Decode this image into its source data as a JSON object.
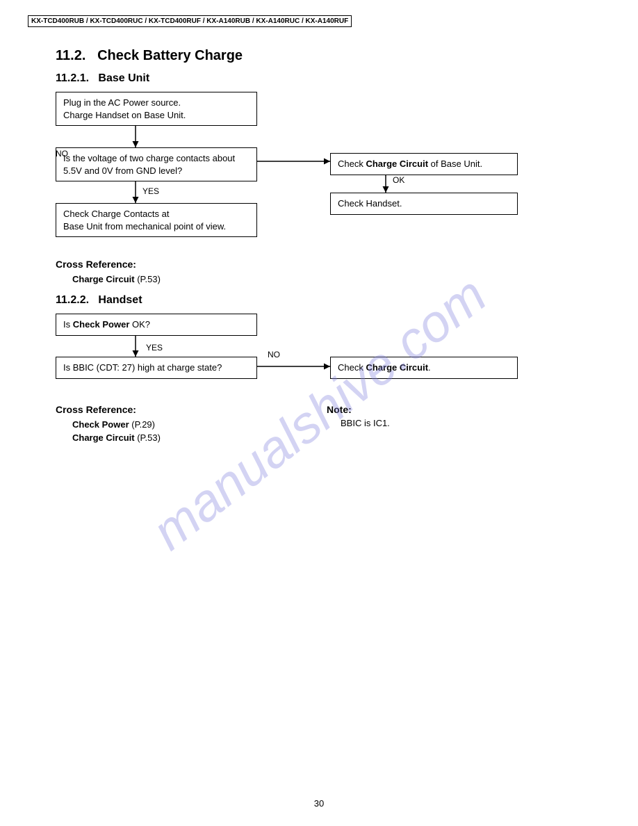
{
  "header": {
    "models": "KX-TCD400RUB / KX-TCD400RUC / KX-TCD400RUF / KX-A140RUB / KX-A140RUC / KX-A140RUF"
  },
  "section": {
    "number": "11.2.",
    "title": "Check Battery Charge"
  },
  "subsection1": {
    "number": "11.2.1.",
    "title": "Base Unit",
    "box1_line1": "Plug in the AC Power source.",
    "box1_line2": "Charge Handset on Base Unit.",
    "box2_line1": "Is the voltage of two charge contacts about",
    "box2_line2": "5.5V and 0V from GND level?",
    "box3_pre": "Check ",
    "box3_bold": "Charge Circuit",
    "box3_post": " of Base Unit.",
    "box4": "Check Handset.",
    "box5_line1": "Check Charge Contacts at",
    "box5_line2": "Base Unit from mechanical point of view.",
    "label_no": "NO",
    "label_ok": "OK",
    "label_yes": "YES",
    "cross_ref_title": "Cross Reference:",
    "cross_ref_item_bold": "Charge Circuit",
    "cross_ref_item_page": " (P.53)"
  },
  "subsection2": {
    "number": "11.2.2.",
    "title": "Handset",
    "box1_pre": "Is ",
    "box1_bold": "Check Power",
    "box1_post": " OK?",
    "box2": "Is BBIC (CDT: 27) high at charge state?",
    "box3_pre": "Check ",
    "box3_bold": "Charge Circuit",
    "box3_post": ".",
    "label_yes": "YES",
    "label_no": "NO",
    "cross_ref_title": "Cross Reference:",
    "cross_ref_item1_bold": "Check Power",
    "cross_ref_item1_page": " (P.29)",
    "cross_ref_item2_bold": "Charge Circuit",
    "cross_ref_item2_page": " (P.53)",
    "note_title": "Note:",
    "note_text": "BBIC is IC1."
  },
  "page_number": "30",
  "watermark": "manualshive.com"
}
